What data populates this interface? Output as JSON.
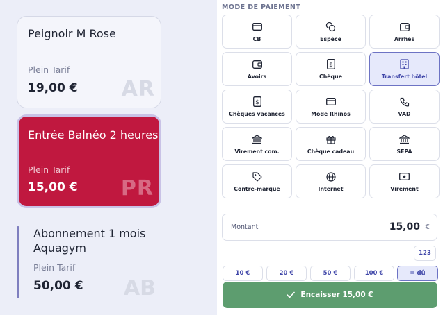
{
  "products": [
    {
      "name": "Peignoir M Rose",
      "tarif": "Plein Tarif",
      "price": "19,00 €",
      "code": "AR"
    },
    {
      "name": "Entrée Balnéo 2 heures",
      "tarif": "Plein Tarif",
      "price": "15,00 €",
      "code": "PR",
      "selected": true
    },
    {
      "name": "Abonnement 1 mois Aquagym",
      "tarif": "Plein Tarif",
      "price": "50,00 €",
      "code": "AB"
    }
  ],
  "payment": {
    "title": "MODE DE PAIEMENT",
    "methods": [
      {
        "label": "CB",
        "icon": "credit-card-icon"
      },
      {
        "label": "Espèce",
        "icon": "coins-icon"
      },
      {
        "label": "Arrhes",
        "icon": "wallet-icon"
      },
      {
        "label": "Avoirs",
        "icon": "wallet-icon"
      },
      {
        "label": "Chèque",
        "icon": "receipt-icon"
      },
      {
        "label": "Transfert hôtel",
        "icon": "building-icon",
        "selected": true
      },
      {
        "label": "Chèques vacances",
        "icon": "receipt-icon"
      },
      {
        "label": "Mode Rhinos",
        "icon": "credit-card-icon"
      },
      {
        "label": "VAD",
        "icon": "phone-icon"
      },
      {
        "label": "Virement com.",
        "icon": "bank-icon"
      },
      {
        "label": "Chèque cadeau",
        "icon": "gift-icon"
      },
      {
        "label": "SEPA",
        "icon": "bank-icon"
      },
      {
        "label": "Contre-marque",
        "icon": "tag-icon"
      },
      {
        "label": "Internet",
        "icon": "globe-icon"
      },
      {
        "label": "Virement",
        "icon": "banknote-icon"
      }
    ]
  },
  "amount": {
    "label": "Montant",
    "value": "15,00",
    "currency": "€"
  },
  "keypad_label": "123",
  "quick_amounts": [
    "10 €",
    "20 €",
    "50 €",
    "100 €",
    "= dû"
  ],
  "cash_button": "Encaisser 15,00 €",
  "colors": {
    "accent": "#c0183f",
    "primary": "#3f46a8",
    "success": "#5d9d6f",
    "panel": "#eceef8"
  }
}
